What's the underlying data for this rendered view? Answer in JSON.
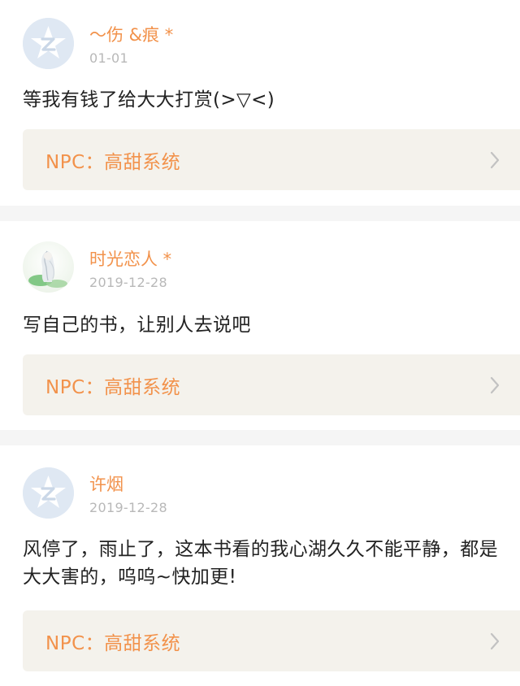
{
  "comments": [
    {
      "username": "～伤 &痕 *",
      "date": "01-01",
      "avatar_icon": "qq-default-avatar-icon",
      "text": "等我有钱了给大大打赏(>▽<)",
      "npc_label": "NPC：高甜系统"
    },
    {
      "username": "时光恋人 *",
      "date": "2019-12-28",
      "avatar_icon": "anime-girl-avatar",
      "text": "写自己的书，让别人去说吧",
      "npc_label": "NPC：高甜系统"
    },
    {
      "username": "许烟",
      "date": "2019-12-28",
      "avatar_icon": "qq-default-avatar-icon",
      "text": "风停了，雨止了，这本书看的我心湖久久不能平静，都是大大害的，呜呜~快加更!",
      "npc_label": "NPC：高甜系统"
    }
  ],
  "colors": {
    "accent": "#f2924b",
    "date_gray": "#b8b8b8",
    "npc_background": "#f4f2ec",
    "avatar_blue": "#dfe8f3"
  }
}
